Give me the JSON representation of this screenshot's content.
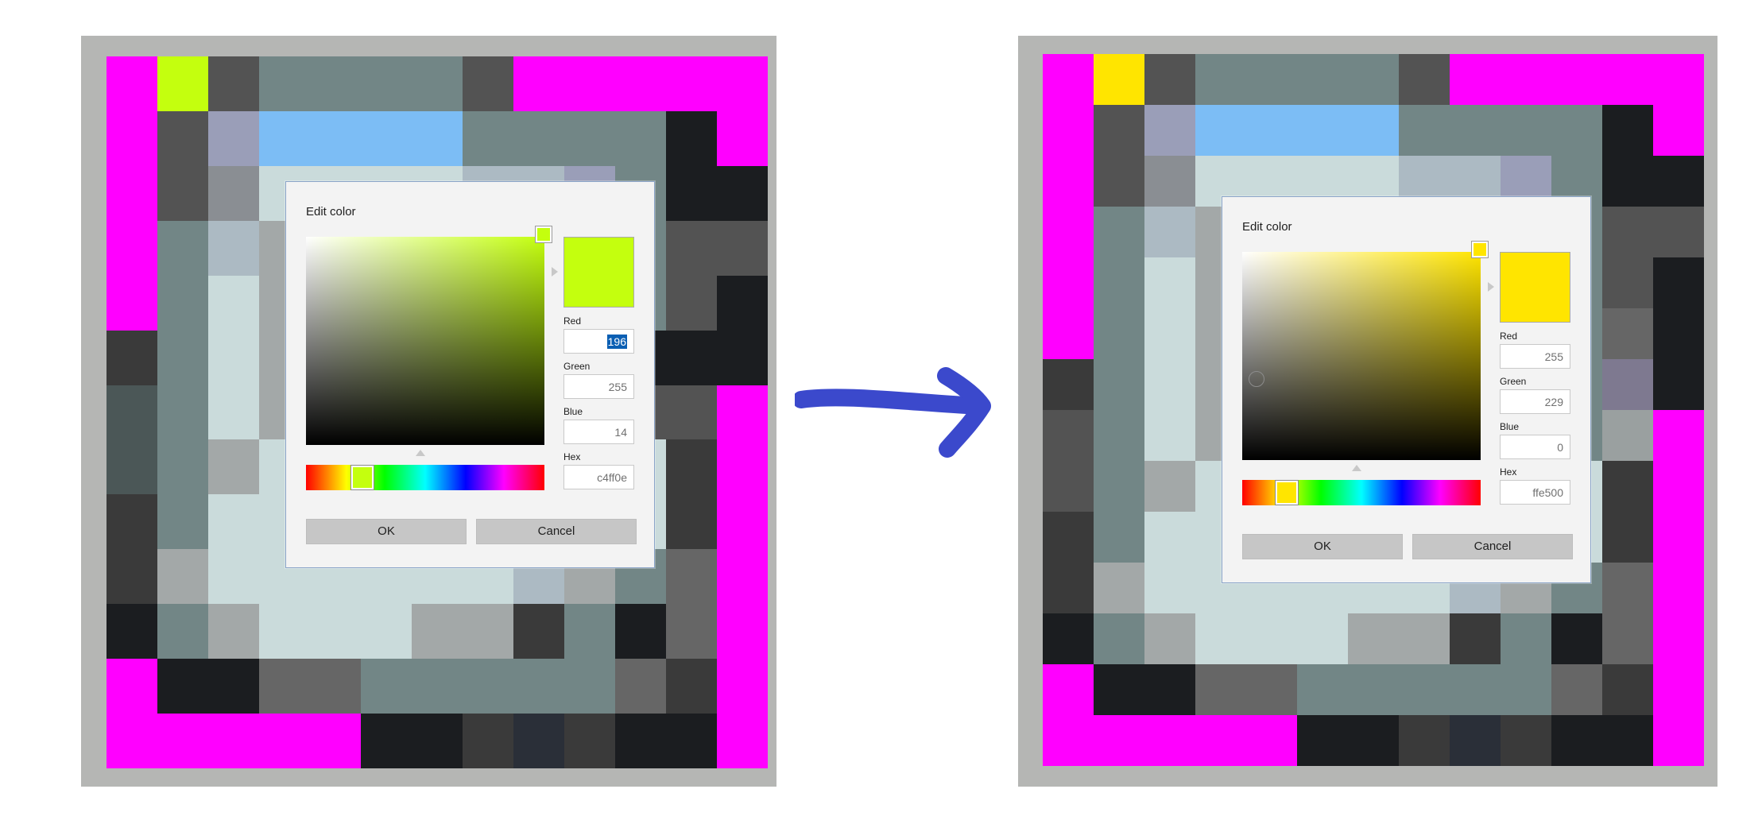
{
  "palette": {
    "M": "#ff00ff",
    "G": "#c4ff0e",
    "Y": "#ffe500",
    "D": "#535353",
    "S": "#728686",
    "B": "#7cbdf5",
    "K": "#1b1d20",
    "L": "#9a9eb8",
    "A": "#cadbdb",
    "P": "#acbac3",
    "H": "#a3a8a8",
    "C": "#3a3a3a",
    "E": "#4b5757",
    "N": "#666666",
    "Q": "#9aa0a0",
    "R": "#8a8e93",
    "V": "#7e7990",
    "U": "#2a2f38"
  },
  "grid_before": [
    "MGDSSSSDMMMMM",
    "MDLBBBBSSSSKM",
    "MDRAAAAPPLSKK",
    "MSPHHHHHHHSDD",
    "MSAHHHHHHHSDK",
    "CSAHHHHHHHKKK",
    "ESAHHHHHHHDDM",
    "ESHAAAAAAAACM",
    "CSAAAAAAAAACM",
    "CHAAAAAAPHSNM",
    "KSHAAAHHCSKNM",
    "MKKNNSSSSSNCM",
    "MMMMMKKCUCKKM"
  ],
  "grid_after": [
    "MYDSSSSDMMMMM",
    "MDLBBBBSSSSKM",
    "MDRAAAAPPLSKK",
    "MSPHHHHHHHSDD",
    "MSAHHHHHHHSDK",
    "MSAHHHHHHHSNK",
    "CSAHHHHHHHSVK",
    "DSAHHHHHHHSQM",
    "DSHAAAAAAAACM",
    "CSAAAAAAAAACM",
    "CHAAAAAAPHSNM",
    "KSHAAAHHCSKNM",
    "MKKNNSSSSSNCM",
    "MMMMMKKCUCKKM"
  ],
  "dialog_before": {
    "title": "Edit color",
    "hue_color": "#c4ff0e",
    "preview_color": "#c4ff0e",
    "red_label": "Red",
    "red_value": "196",
    "green_label": "Green",
    "green_value": "255",
    "blue_label": "Blue",
    "blue_value": "14",
    "hex_label": "Hex",
    "hex_value": "c4ff0e",
    "ok_label": "OK",
    "cancel_label": "Cancel"
  },
  "dialog_after": {
    "title": "Edit color",
    "hue_color": "#ffe500",
    "preview_color": "#ffe500",
    "red_label": "Red",
    "red_value": "255",
    "green_label": "Green",
    "green_value": "229",
    "blue_label": "Blue",
    "blue_value": "0",
    "hex_label": "Hex",
    "hex_value": "ffe500",
    "ok_label": "OK",
    "cancel_label": "Cancel"
  },
  "arrow_color": "#3b49cc",
  "icons": {
    "transition": "right-arrow-icon",
    "pointer": "triangle-pointer-icon"
  }
}
